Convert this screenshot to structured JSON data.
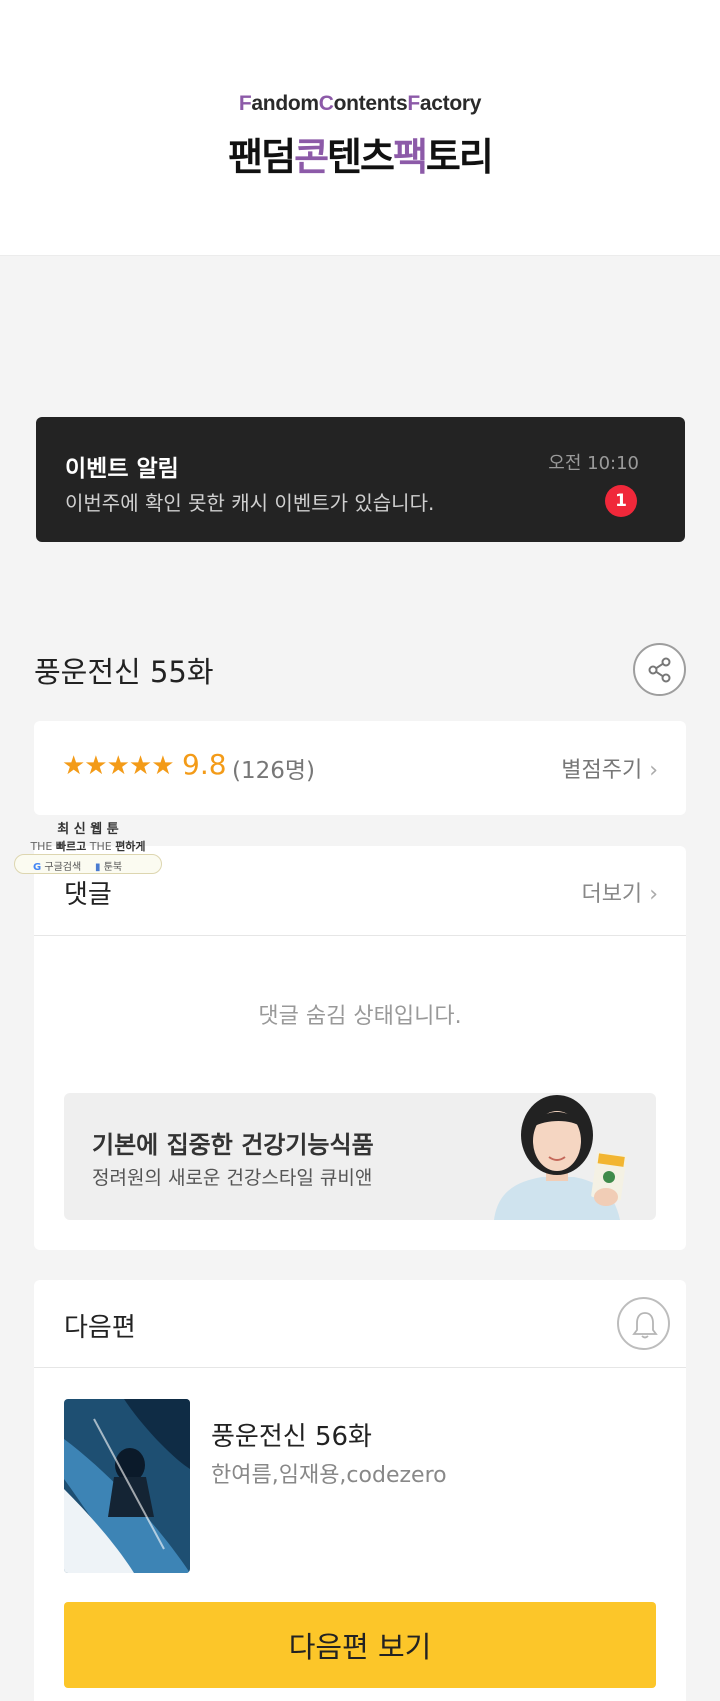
{
  "header": {
    "logo_en": [
      "F",
      "andom",
      "C",
      "ontents",
      "F",
      "actory"
    ],
    "logo_ko": [
      "팬덤",
      "콘",
      "텐츠",
      "팩",
      "토리"
    ]
  },
  "event": {
    "title": "이벤트 알림",
    "message": "이번주에 확인 못한 캐시 이벤트가 있습니다.",
    "time": "오전 10:10",
    "badge": "1"
  },
  "episode": {
    "title": "풍운전신 55화",
    "share_icon": "share-icon"
  },
  "rating": {
    "stars": "★★★★★",
    "score": "9.8",
    "count": "(126명)",
    "rate_label": "별점주기",
    "chevron": "›",
    "star_color": "#f39b18"
  },
  "floating_ad": {
    "line1": "최 신 웹 툰",
    "line2_a": "THE ",
    "line2_b": "빠르고",
    "line2_c": " THE ",
    "line2_d": "편하게",
    "google_label": "구글검색",
    "toonbook_label": "툰북"
  },
  "comments": {
    "label": "댓글",
    "more_label": "더보기",
    "chevron": "›",
    "hidden_message": "댓글 숨김 상태입니다."
  },
  "ad": {
    "headline": "기본에 집중한 건강기능식품",
    "sub": "정려원의 새로운 건강스타일 큐비앤"
  },
  "next": {
    "label": "다음편",
    "bell_icon": "bell-icon",
    "title": "풍운전신 56화",
    "authors": "한여름,임재용,codezero",
    "button_label": "다음편 보기",
    "button_color": "#fcc629"
  },
  "colors": {
    "brand_purple": "#8c5aa8",
    "event_bg": "#232323",
    "badge_red": "#f0283a"
  }
}
